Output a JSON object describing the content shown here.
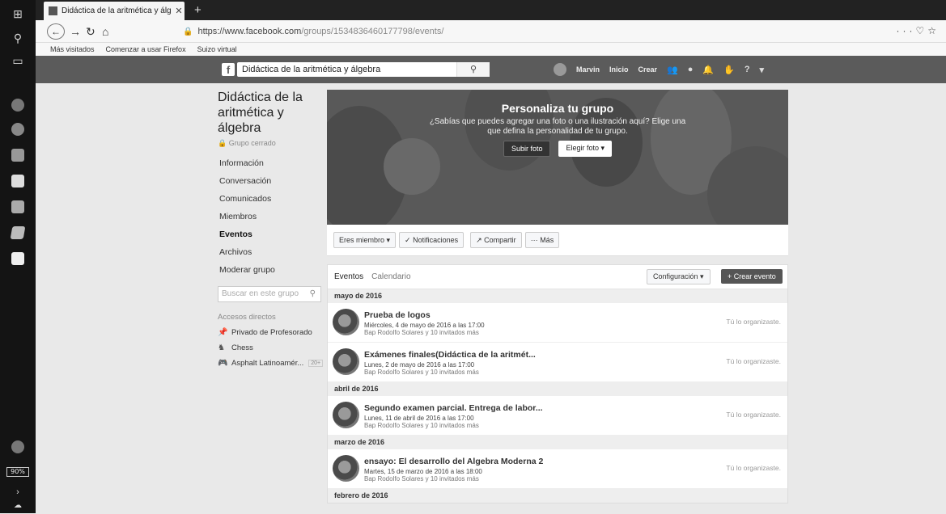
{
  "browser": {
    "tab_title": "Didáctica de la aritmética y álg",
    "url_prefix": "https://www.facebook.com",
    "url_path": "/groups/1534836460177798/events/",
    "bookmarks": [
      "Más visitados",
      "Comenzar a usar Firefox",
      "Suizo virtual"
    ]
  },
  "taskbar": {
    "zoom": "90%"
  },
  "fb": {
    "search_value": "Didáctica de la aritmética y álgebra",
    "user_name": "Marvin",
    "home_label": "Inicio",
    "create_label": "Crear"
  },
  "group": {
    "title": "Didáctica de la aritmética y álgebra",
    "type": "Grupo cerrado",
    "nav": [
      "Información",
      "Conversación",
      "Comunicados",
      "Miembros",
      "Eventos",
      "Archivos",
      "Moderar grupo"
    ],
    "active_nav": "Eventos",
    "search_placeholder": "Buscar en este grupo",
    "shortcuts_header": "Accesos directos",
    "shortcuts": [
      {
        "label": "Privado de Profesorado",
        "icon": "pin-icon"
      },
      {
        "label": "Chess",
        "icon": "chess-icon"
      },
      {
        "label": "Asphalt Latinoamér...",
        "icon": "game-icon",
        "badge": "20+"
      }
    ]
  },
  "cover": {
    "title": "Personaliza tu grupo",
    "subtitle": "¿Sabías que puedes agregar una foto o una ilustración aquí? Elige una que defina la personalidad de tu grupo.",
    "upload_label": "Subir foto",
    "choose_label": "Elegir foto"
  },
  "actions": {
    "member": "Eres miembro",
    "notifications": "Notificaciones",
    "share": "Compartir",
    "more": "Más"
  },
  "events": {
    "tab_events": "Eventos",
    "tab_calendar": "Calendario",
    "config_label": "Configuración",
    "create_label": "+ Crear evento",
    "months": [
      {
        "label": "mayo de 2016",
        "items": [
          {
            "title": "Prueba de logos",
            "date": "Miércoles, 4 de mayo de 2016 a las 17:00",
            "guests": "Bap Rodolfo Solares y 10 invitados más",
            "org": "Tú lo organizaste."
          },
          {
            "title": "Exámenes finales(Didáctica de la aritmét...",
            "date": "Lunes, 2 de mayo de 2016 a las 17:00",
            "guests": "Bap Rodolfo Solares y 10 invitados más",
            "org": "Tú lo organizaste."
          }
        ]
      },
      {
        "label": "abril de 2016",
        "items": [
          {
            "title": "Segundo examen parcial. Entrega de labor...",
            "date": "Lunes, 11 de abril de 2016 a las 17:00",
            "guests": "Bap Rodolfo Solares y 10 invitados más",
            "org": "Tú lo organizaste."
          }
        ]
      },
      {
        "label": "marzo de 2016",
        "items": [
          {
            "title": "ensayo: El desarrollo del Algebra Moderna 2",
            "date": "Martes, 15 de marzo de 2016 a las 18:00",
            "guests": "Bap Rodolfo Solares y 10 invitados más",
            "org": "Tú lo organizaste."
          }
        ]
      },
      {
        "label": "febrero de 2016",
        "items": []
      }
    ]
  }
}
